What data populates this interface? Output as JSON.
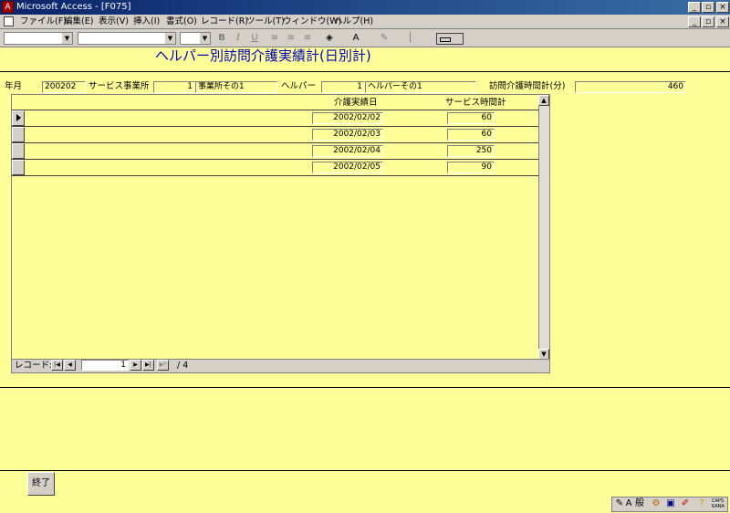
{
  "window": {
    "title": "Microsoft Access - [F075]",
    "app_icon": "access-icon",
    "minimize": "_",
    "restore": "▫",
    "close": "×"
  },
  "menu": {
    "items": [
      "ファイル(F)",
      "編集(E)",
      "表示(V)",
      "挿入(I)",
      "書式(O)",
      "レコード(R)",
      "ツール(T)",
      "ウィンドウ(W)",
      "ヘルプ(H)"
    ],
    "icon": "form-icon"
  },
  "toolbar": {
    "bold": "B",
    "italic": "I",
    "underline": "U"
  },
  "form": {
    "title": "ヘルパー別訪問介護実績計(日別計)",
    "year_month_label": "年月",
    "year_month_value": "200202",
    "service_office_label": "サービス事業所",
    "service_office_code": "1",
    "service_office_name": "事業所その1",
    "helper_label": "ヘルパー",
    "helper_code": "1",
    "helper_name": "ヘルパーその1",
    "total_label": "訪問介護時間計(分)",
    "total_value": "460"
  },
  "subform": {
    "columns": {
      "date": "介護実績日",
      "minutes": "サービス時間計"
    },
    "rows": [
      {
        "date": "2002/02/02",
        "minutes": "60"
      },
      {
        "date": "2002/02/03",
        "minutes": "60"
      },
      {
        "date": "2002/02/04",
        "minutes": "250"
      },
      {
        "date": "2002/02/05",
        "minutes": "90"
      }
    ],
    "nav": {
      "label": "レコード:",
      "current": "1",
      "total": "/ 4"
    }
  },
  "footer": {
    "end_button": "終了"
  },
  "ime": {
    "caps": "CAPS",
    "kana": "KANA",
    "mode": "般"
  },
  "colors": {
    "form_background": "#ffff99",
    "titlebar": "#0a246a",
    "title_text": "#0000c0"
  }
}
